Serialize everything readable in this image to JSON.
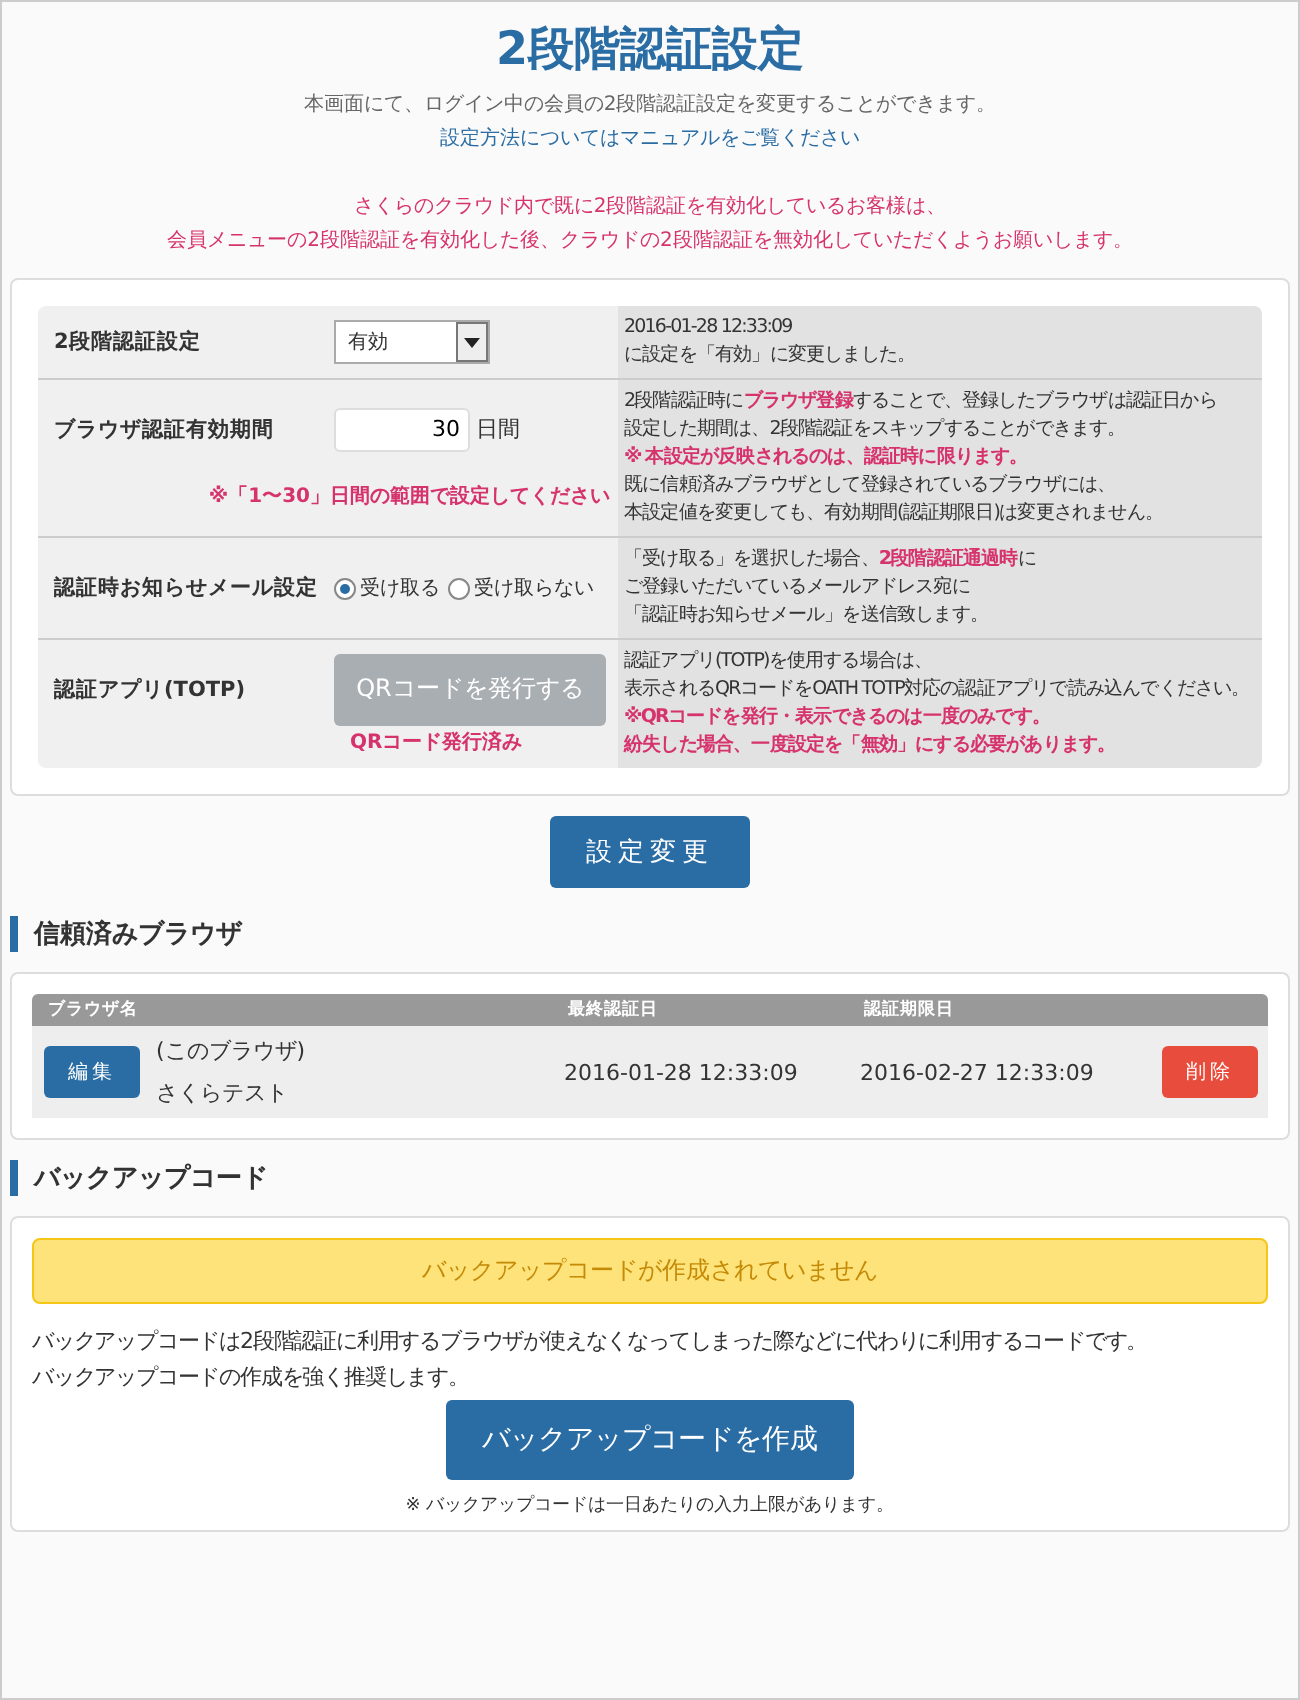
{
  "title": "2段階認証設定",
  "intro": "本画面にて、ログイン中の会員の2段階認証設定を変更することができます。",
  "manual_link": "設定方法についてはマニュアルをご覧ください",
  "warning": [
    "さくらのクラウド内で既に2段階認証を有効化しているお客様は、",
    "会員メニューの2段階認証を有効化した後、クラウドの2段階認証を無効化していただくようお願いします。"
  ],
  "settings": [
    {
      "kind": "select",
      "label": "2段階認証設定",
      "value": "有効",
      "notes": [
        {
          "text": "2016-01-28 12:33:09",
          "emphasis": false
        },
        {
          "text": "に設定を「有効」に変更しました。",
          "emphasis": false
        }
      ]
    },
    {
      "kind": "number",
      "label": "ブラウザ認証有効期間",
      "value": "30",
      "unit": "日間",
      "hint": "※「1〜30」日間の範囲で設定してください",
      "notes": [
        {
          "text": "2段階認証時に**ブラウザ登録**することで、登録したブラウザは認証日から",
          "emphasis": false
        },
        {
          "text": "設定した期間は、2段階認証をスキップすることができます。",
          "emphasis": false
        },
        {
          "text": "※ 本設定が反映されるのは、認証時に限ります。",
          "emphasis": true
        },
        {
          "text": "既に信頼済みブラウザとして登録されているブラウザには、",
          "emphasis": false
        },
        {
          "text": "本設定値を変更しても、有効期間(認証期限日)は変更されません。",
          "emphasis": false
        }
      ]
    },
    {
      "kind": "radio",
      "label": "認証時お知らせメール設定",
      "options": [
        {
          "label": "受け取る",
          "selected": true
        },
        {
          "label": "受け取らない",
          "selected": false
        }
      ],
      "notes": [
        {
          "text": "「受け取る」を選択した場合、**2段階認証通過時**に",
          "emphasis": false
        },
        {
          "text": "ご登録いただいているメールアドレス宛に",
          "emphasis": false
        },
        {
          "text": "「認証時お知らせメール」を送信致します。",
          "emphasis": false
        }
      ]
    },
    {
      "kind": "button",
      "label": "認証アプリ(TOTP)",
      "button": "QRコードを発行する",
      "disabled": true,
      "hint": "QRコード発行済み",
      "notes": [
        {
          "text": "認証アプリ(TOTP)を使用する場合は、",
          "emphasis": false
        },
        {
          "text": "表示されるQRコードをOATH TOTP対応の認証アプリで読み込んでください。",
          "emphasis": false
        },
        {
          "text": "※QRコードを発行・表示できるのは一度のみです。",
          "emphasis": true
        },
        {
          "text": "紛失した場合、一度設定を「無効」にする必要があります。",
          "emphasis": true
        }
      ]
    }
  ],
  "submit": "設定変更",
  "trusted": {
    "heading": "信頼済みブラウザ",
    "columns": [
      "ブラウザ名",
      "最終認証日",
      "認証期限日"
    ],
    "rows": [
      {
        "edit": "編集",
        "note": "(このブラウザ)",
        "name": "さくらテスト",
        "last_auth": "2016-01-28 12:33:09",
        "expires": "2016-02-27 12:33:09",
        "delete": "削除"
      }
    ]
  },
  "backup": {
    "heading": "バックアップコード",
    "alert": "バックアップコードが作成されていません",
    "description": [
      "バックアップコードは2段階認証に利用するブラウザが使えなくなってしまった際などに代わりに利用するコードです。",
      "バックアップコードの作成を強く推奨します。"
    ],
    "button": "バックアップコードを作成",
    "footnote": "※ バックアップコードは一日あたりの入力上限があります。"
  }
}
